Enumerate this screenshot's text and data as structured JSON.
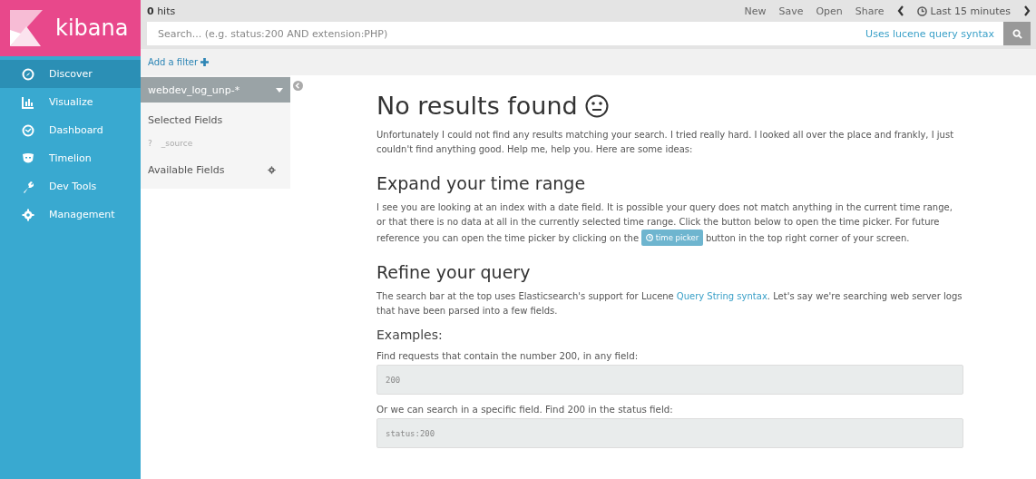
{
  "sidebar": {
    "logo": "kibana",
    "items": [
      {
        "label": "Discover",
        "selected": true
      },
      {
        "label": "Visualize",
        "selected": false
      },
      {
        "label": "Dashboard",
        "selected": false
      },
      {
        "label": "Timelion",
        "selected": false
      },
      {
        "label": "Dev Tools",
        "selected": false
      },
      {
        "label": "Management",
        "selected": false
      }
    ]
  },
  "top_bar": {
    "hits_count": "0",
    "hits_label": "hits",
    "actions": [
      "New",
      "Save",
      "Open",
      "Share"
    ],
    "time_range": "Last 15 minutes"
  },
  "search": {
    "placeholder": "Search... (e.g. status:200 AND extension:PHP)",
    "syntax_link": "Uses lucene query syntax"
  },
  "filter_bar": {
    "add_filter": "Add a filter"
  },
  "field_panel": {
    "index_pattern": "webdev_log_unp-*",
    "selected_heading": "Selected Fields",
    "selected_fields": [
      {
        "type": "?",
        "name": "_source"
      }
    ],
    "available_heading": "Available Fields"
  },
  "main": {
    "title": "No results found",
    "intro": "Unfortunately I could not find any results matching your search. I tried really hard. I looked all over the place and frankly, I just couldn't find anything good. Help me, help you. Here are some ideas:",
    "sections": [
      {
        "heading": "Expand your time range",
        "before": "I see you are looking at an index with a date field. It is possible your query does not match anything in the current time range, or that there is no data at all in the currently selected time range. Click the button below to open the time picker. For future reference you can open the time picker by clicking on the",
        "inline": {
          "kind": "button",
          "text": "time picker"
        },
        "after": "button in the top right corner of your screen."
      },
      {
        "heading": "Refine your query",
        "before": "The search bar at the top uses Elasticsearch's support for Lucene",
        "inline": {
          "kind": "link",
          "text": "Query String syntax"
        },
        "after": ". Let's say we're searching web server logs that have been parsed into a few fields."
      }
    ],
    "examples_heading": "Examples:",
    "examples": [
      {
        "description": "Find requests that contain the number 200, in any field:",
        "code": "200"
      },
      {
        "description": "Or we can search in a specific field. Find 200 in the status field:",
        "code": "status:200"
      }
    ]
  }
}
